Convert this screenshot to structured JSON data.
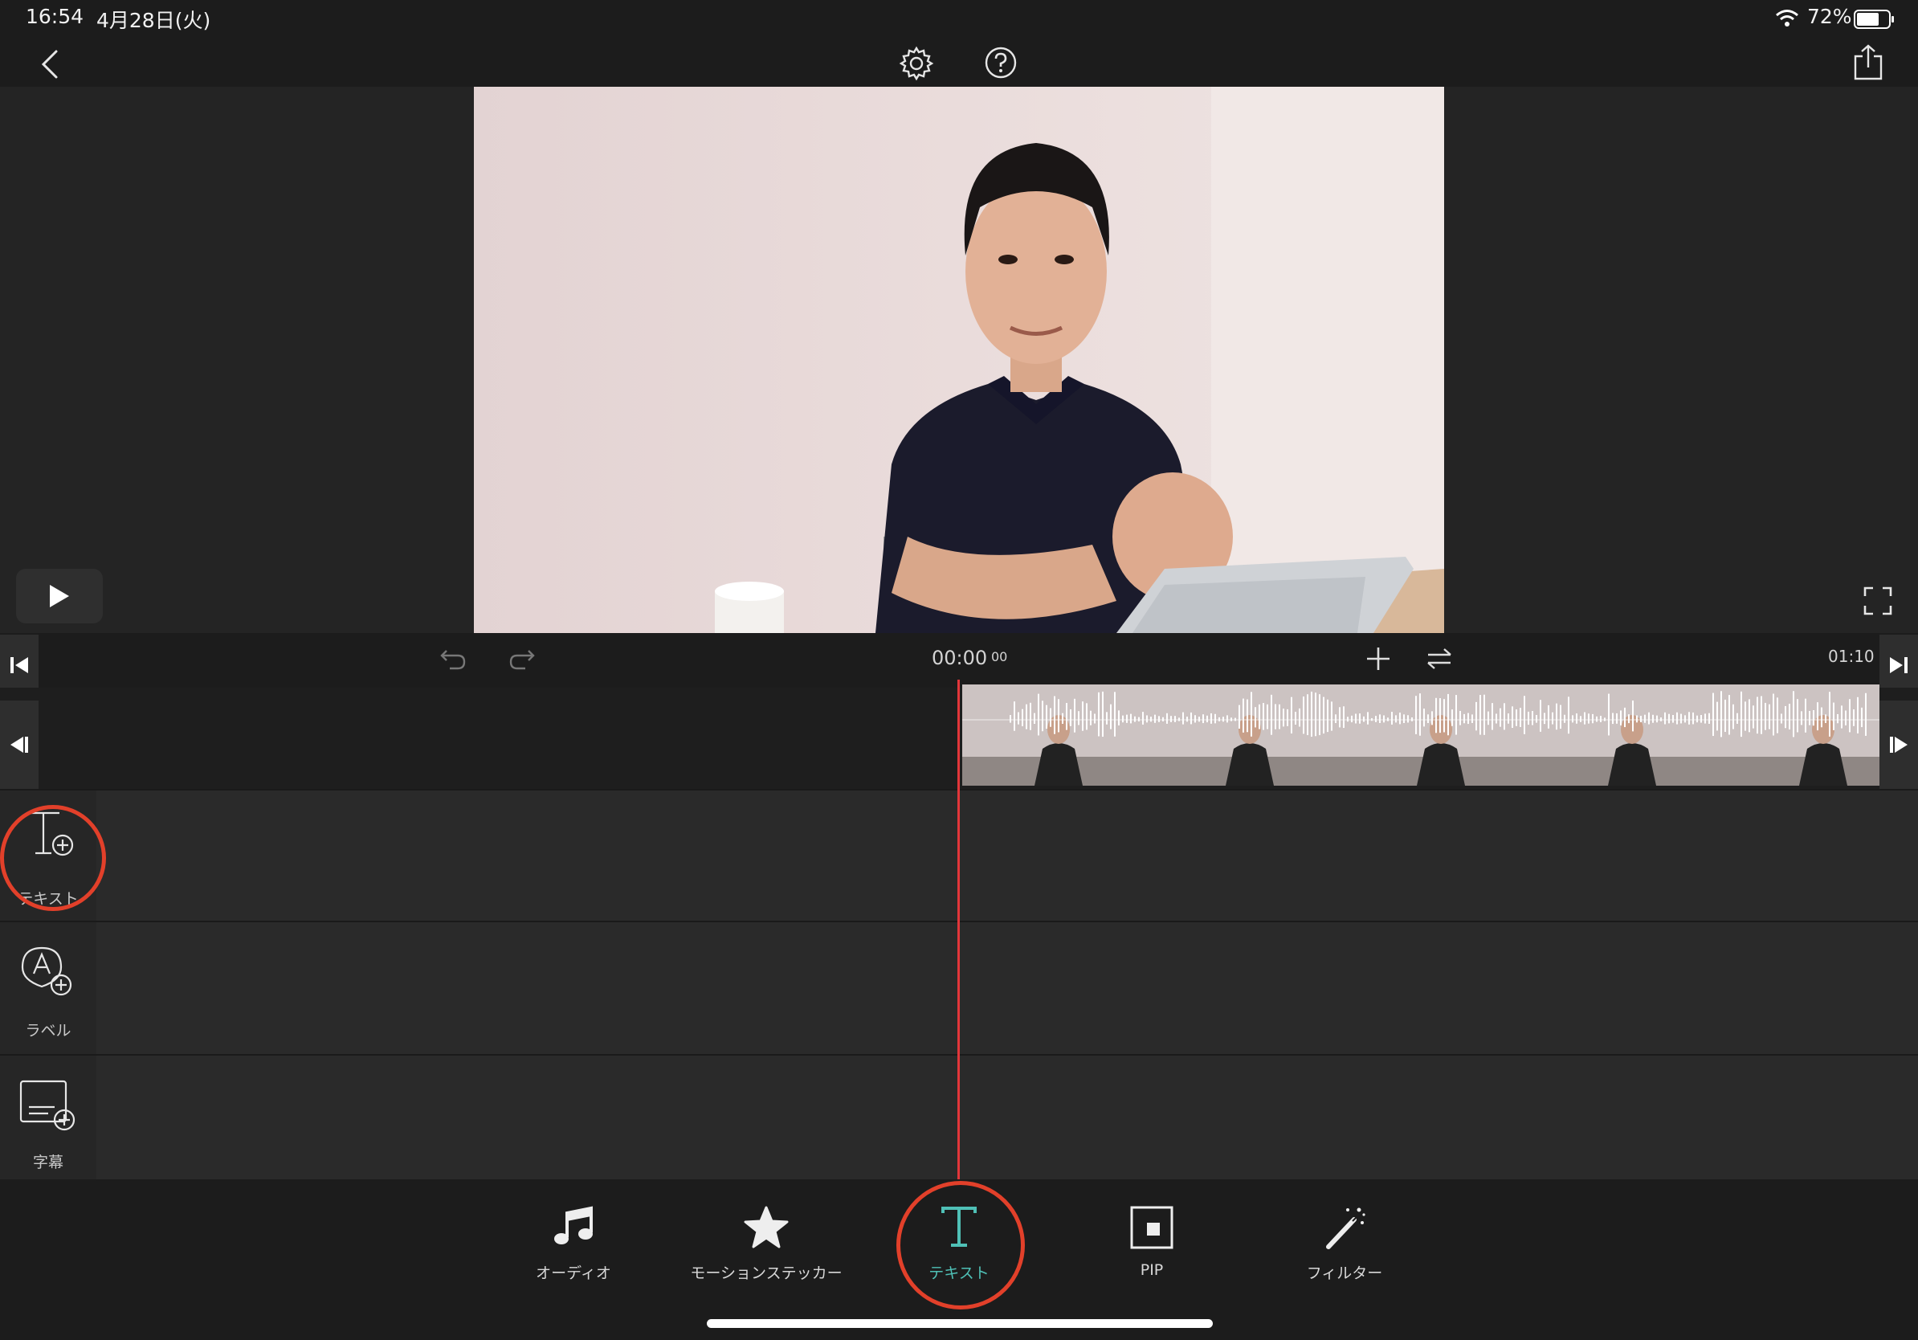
{
  "status_bar": {
    "time": "16:54",
    "date": "4月28日(火)",
    "battery_percent": "72%",
    "battery_level": 0.72,
    "icons": [
      "wifi-icon",
      "battery-icon"
    ]
  },
  "top_bar": {
    "icons": [
      "back-chevron-icon",
      "gear-icon",
      "help-icon",
      "share-icon"
    ]
  },
  "timeline": {
    "current_time": "00:00",
    "current_frames": "00",
    "total_time": "01:10"
  },
  "layers": [
    {
      "label": "テキスト",
      "icon": "text-add-icon"
    },
    {
      "label": "ラベル",
      "icon": "label-add-icon"
    },
    {
      "label": "字幕",
      "icon": "subtitle-add-icon"
    }
  ],
  "bottom_tools": [
    {
      "label": "オーディオ",
      "icon": "music-note-icon"
    },
    {
      "label": "モーションステッカー",
      "icon": "star-sticker-icon"
    },
    {
      "label": "テキスト",
      "icon": "text-icon"
    },
    {
      "label": "PIP",
      "icon": "pip-icon"
    },
    {
      "label": "フィルター",
      "icon": "magic-wand-icon"
    }
  ],
  "colors": {
    "accent": "#4fc0b6",
    "playhead": "#e2363a",
    "annotation_ring": "#e2402a"
  }
}
